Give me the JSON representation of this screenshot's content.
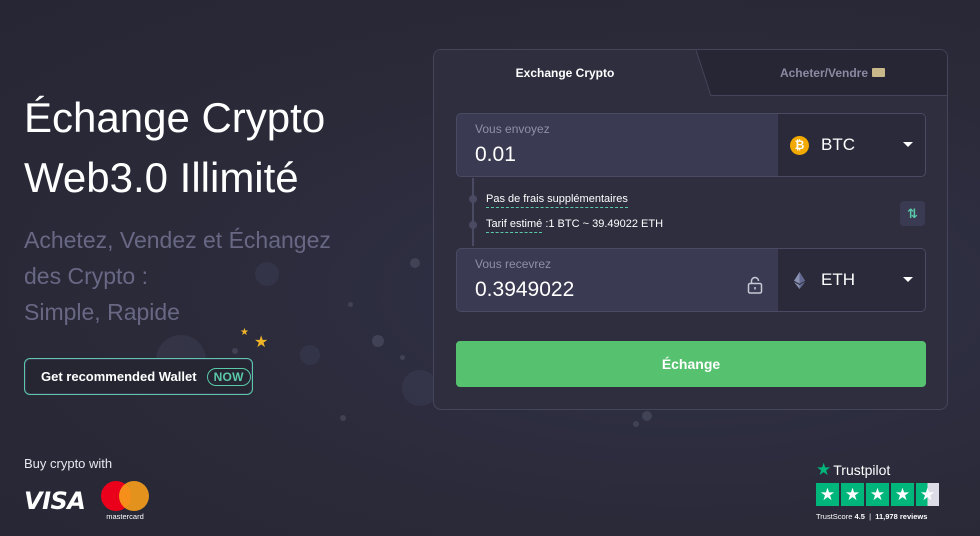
{
  "hero": {
    "title_line1": "Échange Crypto",
    "title_line2": "Web3.0 Illimité",
    "sub_line1": "Achetez, Vendez et Échangez",
    "sub_line2": "des Crypto :",
    "sub_line3": "Simple, Rapide"
  },
  "wallet_button": {
    "label": "Get recommended Wallet",
    "badge": "NOW"
  },
  "payments": {
    "caption": "Buy crypto with",
    "visa": "VISA",
    "mastercard": "mastercard"
  },
  "trustpilot": {
    "brand": "Trustpilot",
    "score_label": "TrustScore",
    "score": "4.5",
    "reviews": "11,978 reviews",
    "stars": 4.5
  },
  "widget": {
    "tabs": [
      {
        "label": "Exchange Crypto",
        "active": true
      },
      {
        "label": "Acheter/Vendre",
        "active": false
      }
    ],
    "send": {
      "label": "Vous envoyez",
      "value": "0.01",
      "currency": "BTC",
      "currency_icon": "bitcoin-icon"
    },
    "info": {
      "fees": "Pas de frais supplémentaires",
      "rate_label": "Tarif estimé",
      "rate_value": ":1 BTC ~ 39.49022 ETH"
    },
    "receive": {
      "label": "Vous recevrez",
      "value": "0.3949022",
      "currency": "ETH",
      "currency_icon": "ethereum-icon"
    },
    "exchange_button": "Échange"
  },
  "colors": {
    "background": "#2b2b3a",
    "accent_green": "#56c16f",
    "teal": "#5ac9a8",
    "trustpilot_green": "#00b67a",
    "bitcoin": "#f2a900"
  }
}
